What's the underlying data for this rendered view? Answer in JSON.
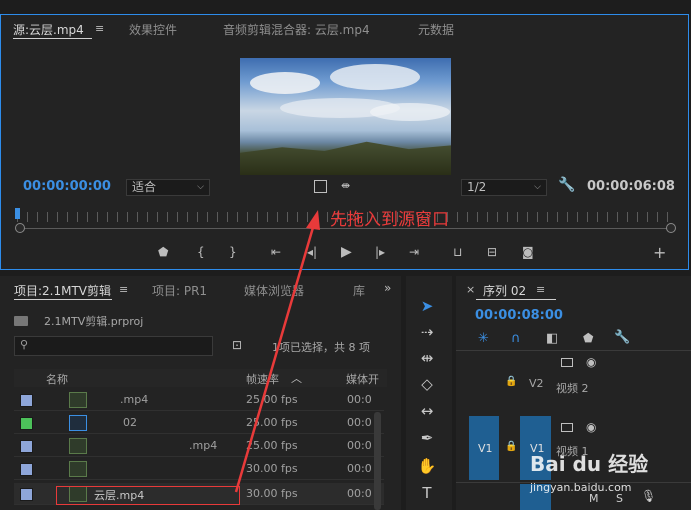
{
  "source_monitor": {
    "tabs": [
      "源:云层.mp4",
      "效果控件",
      "音频剪辑混合器: 云层.mp4",
      "元数据"
    ],
    "timecode_current": "00:00:00:00",
    "fit_select": "适合",
    "resolution_select": "1/2",
    "timecode_duration": "00:00:06:08",
    "transport_buttons": [
      "marker-icon",
      "mark-in-icon",
      "mark-out-icon",
      "go-to-in-icon",
      "step-back-icon",
      "play-icon",
      "step-forward-icon",
      "go-to-out-icon",
      "insert-icon",
      "overwrite-icon",
      "export-frame-icon",
      "add-button-icon"
    ]
  },
  "annotation": {
    "text": "先拖入到源窗口",
    "color": "#e83a3a"
  },
  "project_panel": {
    "tabs": [
      "项目:2.1MTV剪辑",
      "项目: PR1",
      "媒体浏览器",
      "库"
    ],
    "project_file": "2.1MTV剪辑.prproj",
    "selection_status": "1项已选择，共 8 项",
    "columns": {
      "name": "名称",
      "frame_rate": "帧速率",
      "media_start": "媒体开"
    },
    "rows": [
      {
        "label_color": "#8ea6d9",
        "icon": "clip-icon",
        "name": ".mp4",
        "fps": "25.00 fps",
        "start": "00:0"
      },
      {
        "label_color": "#4cc15a",
        "icon": "sequence-icon",
        "name": "02",
        "fps": "25.00 fps",
        "start": "00:0"
      },
      {
        "label_color": "#8ea6d9",
        "icon": "clip-icon",
        "name": ".mp4",
        "fps": "25.00 fps",
        "start": "00:0"
      },
      {
        "label_color": "#8ea6d9",
        "icon": "clip-icon",
        "name": "",
        "fps": "30.00 fps",
        "start": "00:0"
      },
      {
        "label_color": "#8ea6d9",
        "icon": "clip-icon",
        "name": "云层.mp4",
        "fps": "30.00 fps",
        "start": "00:0"
      }
    ]
  },
  "timeline": {
    "tab": "序列 02",
    "timecode": "00:00:08:00",
    "tracks": [
      {
        "id": "V2",
        "label": "视频 2"
      },
      {
        "id": "V1",
        "label": "视频 1"
      }
    ],
    "patch_label": "V1",
    "audio_controls": [
      "M",
      "S"
    ]
  },
  "watermark": {
    "brand": "Bai du 经验",
    "url": "jingyan.baidu.com"
  }
}
